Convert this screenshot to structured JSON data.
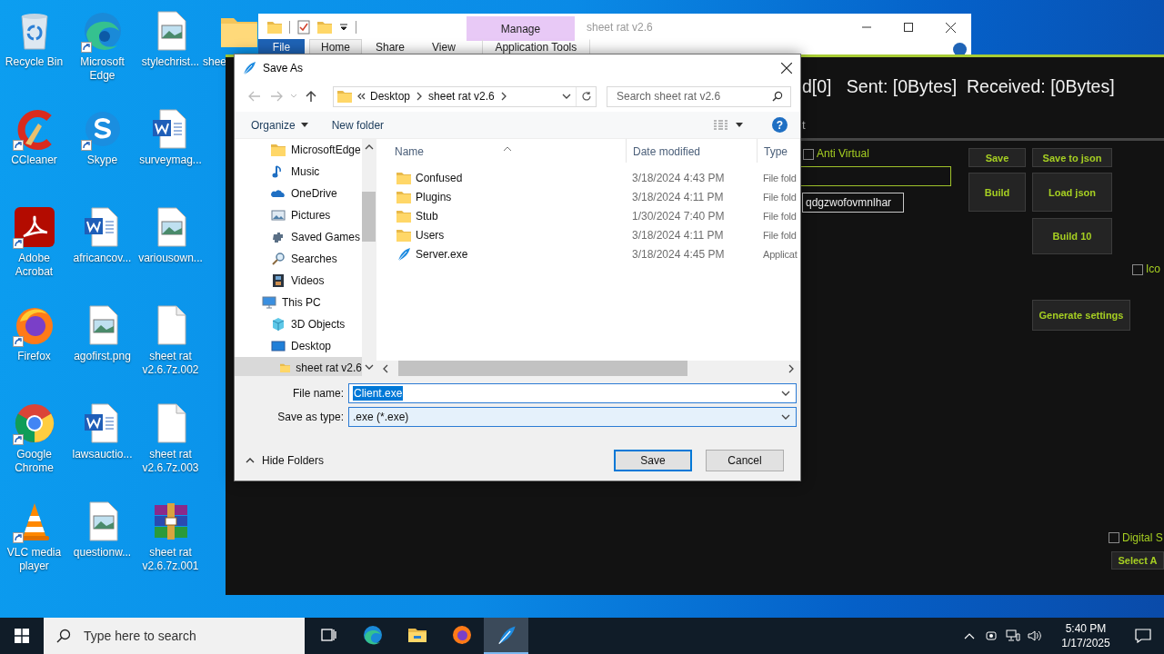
{
  "desktop_icons": [
    {
      "label": "Recycle Bin",
      "kind": "recycle",
      "shortcut": false
    },
    {
      "label": "CCleaner",
      "kind": "ccleaner",
      "shortcut": true
    },
    {
      "label": "Adobe Acrobat",
      "kind": "acrobat",
      "shortcut": true
    },
    {
      "label": "Firefox",
      "kind": "firefox",
      "shortcut": true
    },
    {
      "label": "Google Chrome",
      "kind": "chrome",
      "shortcut": true
    },
    {
      "label": "VLC media player",
      "kind": "vlc",
      "shortcut": true
    },
    {
      "label": "Microsoft Edge",
      "kind": "edge",
      "shortcut": true
    },
    {
      "label": "Skype",
      "kind": "skype",
      "shortcut": true
    },
    {
      "label": "africancov...",
      "kind": "word",
      "shortcut": false
    },
    {
      "label": "agofirst.png",
      "kind": "image",
      "shortcut": false
    },
    {
      "label": "lawsauctio...",
      "kind": "word",
      "shortcut": false
    },
    {
      "label": "questionw...",
      "kind": "image",
      "shortcut": false
    },
    {
      "label": "stylechrist...",
      "kind": "image",
      "shortcut": false
    },
    {
      "label": "surveymag...",
      "kind": "word",
      "shortcut": false
    },
    {
      "label": "variousown...",
      "kind": "image",
      "shortcut": false
    },
    {
      "label": "sheet rat v2.6.7z.002",
      "kind": "blank",
      "shortcut": false
    },
    {
      "label": "sheet rat v2.6.7z.003",
      "kind": "blank",
      "shortcut": false
    },
    {
      "label": "sheet rat v2.6.7z.001",
      "kind": "winrar",
      "shortcut": false
    },
    {
      "label": "shee",
      "kind": "folder",
      "shortcut": false
    }
  ],
  "explorer_window": {
    "title": "sheet rat v2.6",
    "context_header": "Manage",
    "ribbon_tabs": [
      {
        "label": "File",
        "kind": "file",
        "selected": false
      },
      {
        "label": "Home",
        "kind": "tab",
        "selected": true
      },
      {
        "label": "Share",
        "kind": "tab",
        "selected": false
      },
      {
        "label": "View",
        "kind": "tab",
        "selected": false
      },
      {
        "label": "Application Tools",
        "kind": "context",
        "selected": false
      }
    ]
  },
  "builder_window": {
    "status": "d[0]   Sent: [0Bytes]  Received: [0Bytes]",
    "tab_fragment": "t",
    "id_field": "qdgzwofovmnlhar",
    "options": [
      {
        "label": "Anti Virtual",
        "checked": false
      },
      {
        "label": "Ico",
        "checked": false
      },
      {
        "label": "Digital S",
        "checked": false
      }
    ],
    "buttons": [
      "Save",
      "Save to json",
      "Build",
      "Load json",
      "Build 10",
      "Generate settings",
      "Select A"
    ]
  },
  "save_dialog": {
    "title": "Save As",
    "breadcrumb": [
      "Desktop",
      "sheet rat v2.6"
    ],
    "search_placeholder": "Search sheet rat v2.6",
    "organize": "Organize",
    "new_folder": "New folder",
    "help": "?",
    "nav_tree": [
      {
        "children": [
          {
            "label": "MicrosoftEdge",
            "kind": "folder",
            "selected": false
          },
          {
            "label": "Music",
            "kind": "music",
            "selected": false
          },
          {
            "label": "OneDrive",
            "kind": "cloud",
            "selected": false
          },
          {
            "label": "Pictures",
            "kind": "pictures",
            "selected": false
          },
          {
            "label": "Saved Games",
            "kind": "games",
            "selected": false
          },
          {
            "label": "Searches",
            "kind": "search",
            "selected": false
          },
          {
            "label": "Videos",
            "kind": "videos",
            "selected": false
          }
        ]
      },
      {
        "label": "This PC",
        "kind": "pc",
        "selected": false,
        "children": [
          {
            "label": "3D Objects",
            "kind": "cube",
            "selected": false
          },
          {
            "label": "Desktop",
            "kind": "desktop",
            "selected": false,
            "children": [
              {
                "label": "sheet rat v2.6",
                "kind": "folder",
                "selected": true
              }
            ]
          }
        ]
      }
    ],
    "columns": [
      "Name",
      "Date modified",
      "Type"
    ],
    "files": [
      {
        "name": "Confused",
        "date": "3/18/2024 4:43 PM",
        "type": "File fold",
        "kind": "folder"
      },
      {
        "name": "Plugins",
        "date": "3/18/2024 4:11 PM",
        "type": "File fold",
        "kind": "folder"
      },
      {
        "name": "Stub",
        "date": "1/30/2024 7:40 PM",
        "type": "File fold",
        "kind": "folder"
      },
      {
        "name": "Users",
        "date": "3/18/2024 4:11 PM",
        "type": "File fold",
        "kind": "folder"
      },
      {
        "name": "Server.exe",
        "date": "3/18/2024 4:45 PM",
        "type": "Applicat",
        "kind": "app"
      }
    ],
    "file_name_label": "File name:",
    "file_name": "Client.exe",
    "file_name_selected": true,
    "type_label": "Save as type:",
    "save_type": ".exe (*.exe)",
    "hide_folders": "Hide Folders",
    "save": "Save",
    "cancel": "Cancel"
  },
  "taskbar": {
    "search_placeholder": "Type here to search",
    "apps": [
      {
        "kind": "taskview",
        "selected": false
      },
      {
        "kind": "edge",
        "selected": false
      },
      {
        "kind": "explorer",
        "selected": false
      },
      {
        "kind": "firefox",
        "selected": false
      },
      {
        "kind": "feather",
        "selected": true
      }
    ],
    "time": "5:40 PM",
    "date": "1/17/2025"
  }
}
